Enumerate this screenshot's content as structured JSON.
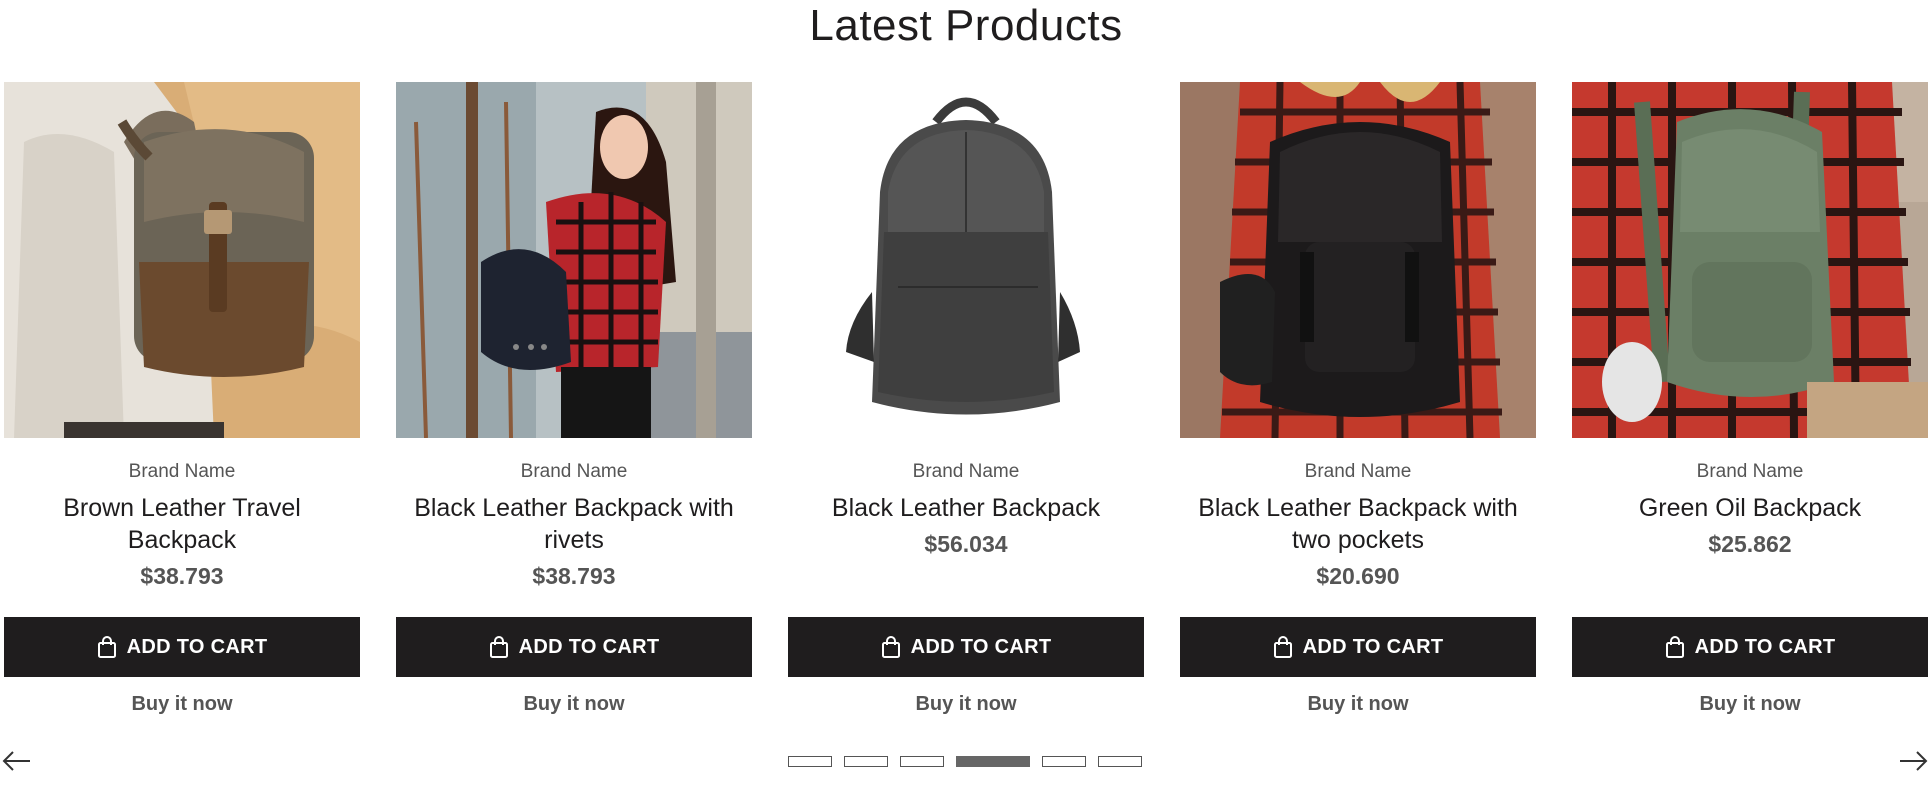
{
  "section": {
    "title": "Latest Products"
  },
  "products": [
    {
      "brand": "Brand Name",
      "title": "Brown Leather Travel Backpack",
      "price": "$38.793",
      "cart_label": "ADD TO CART",
      "buy_label": "Buy it now",
      "image": "brown leather travel backpack"
    },
    {
      "brand": "Brand Name",
      "title": "Black Leather Backpack with rivets",
      "price": "$38.793",
      "cart_label": "ADD TO CART",
      "buy_label": "Buy it now",
      "image": "black leather backpack with rivets"
    },
    {
      "brand": "Brand Name",
      "title": "Black Leather Backpack",
      "price": "$56.034",
      "cart_label": "ADD TO CART",
      "buy_label": "Buy it now",
      "image": "black leather backpack"
    },
    {
      "brand": "Brand Name",
      "title": "Black Leather Backpack with two pockets",
      "price": "$20.690",
      "cart_label": "ADD TO CART",
      "buy_label": "Buy it now",
      "image": "black leather backpack with two pockets"
    },
    {
      "brand": "Brand Name",
      "title": "Green Oil Backpack",
      "price": "$25.862",
      "cart_label": "ADD TO CART",
      "buy_label": "Buy it now",
      "image": "green oil backpack"
    }
  ],
  "pagination": {
    "count": 6,
    "active_index": 3
  },
  "icons": {
    "prev": "arrow-left-icon",
    "next": "arrow-right-icon",
    "cart": "shopping-bag-icon"
  },
  "colors": {
    "button_bg": "#1f1d1e",
    "button_text": "#ffffff",
    "muted_text": "#555555"
  }
}
